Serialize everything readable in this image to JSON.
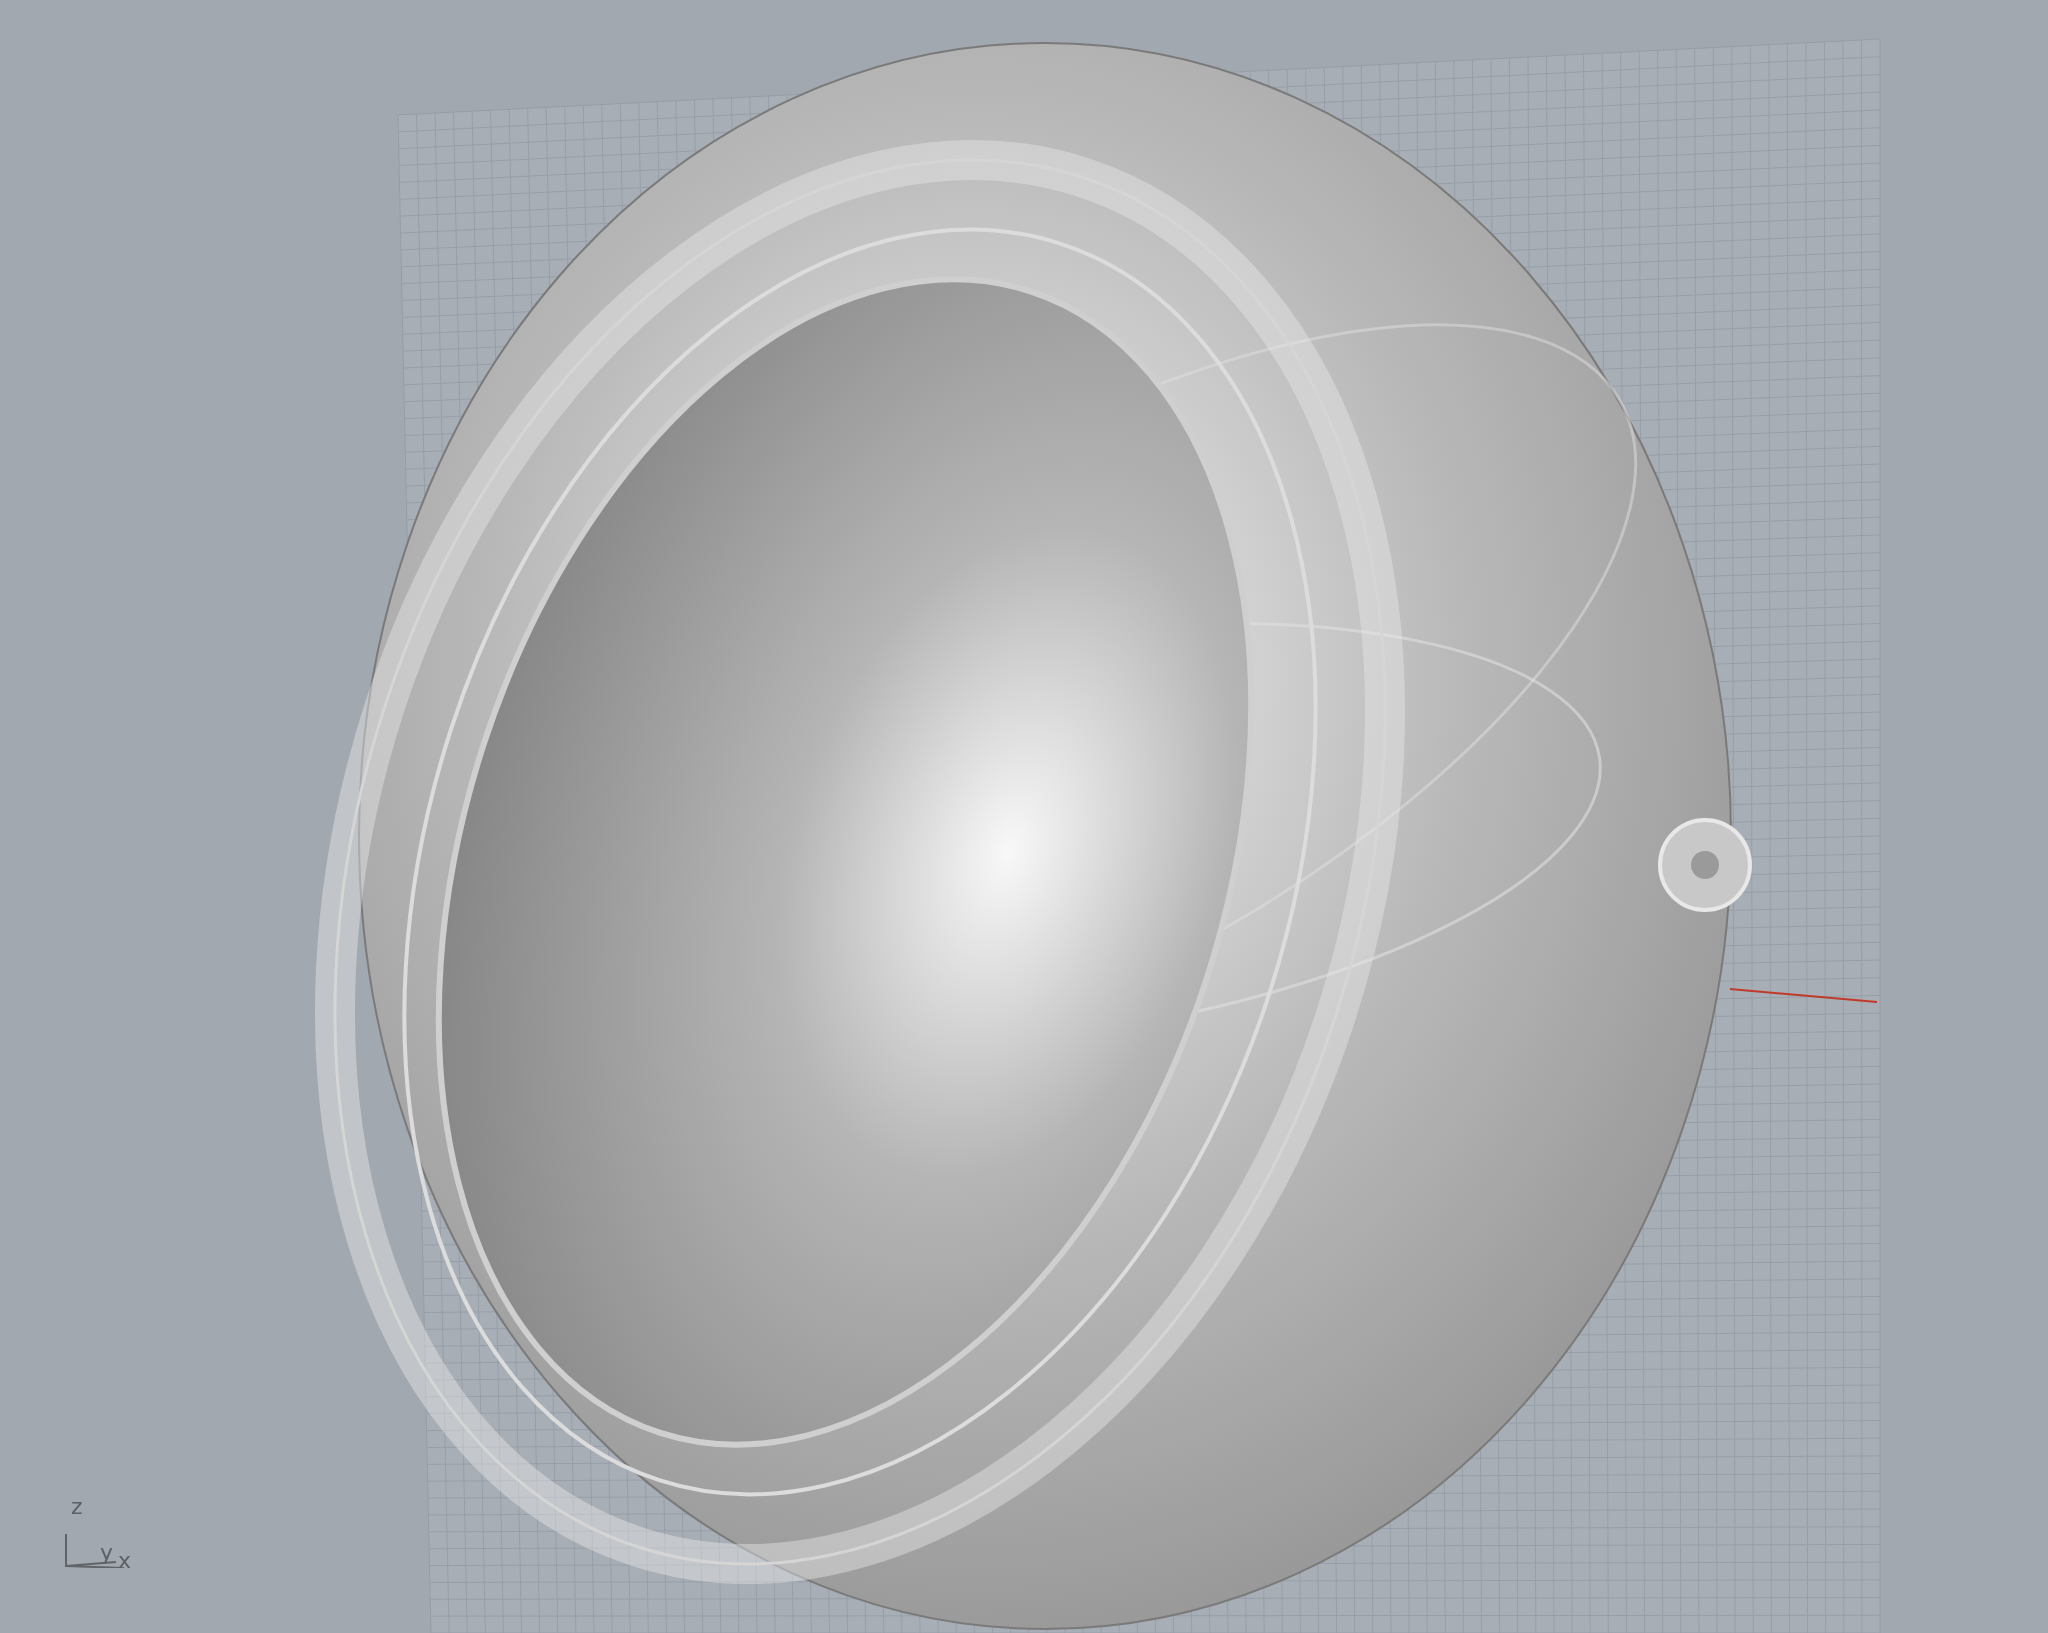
{
  "viewport": {
    "axis_labels": [
      "z",
      "y",
      "x"
    ]
  }
}
